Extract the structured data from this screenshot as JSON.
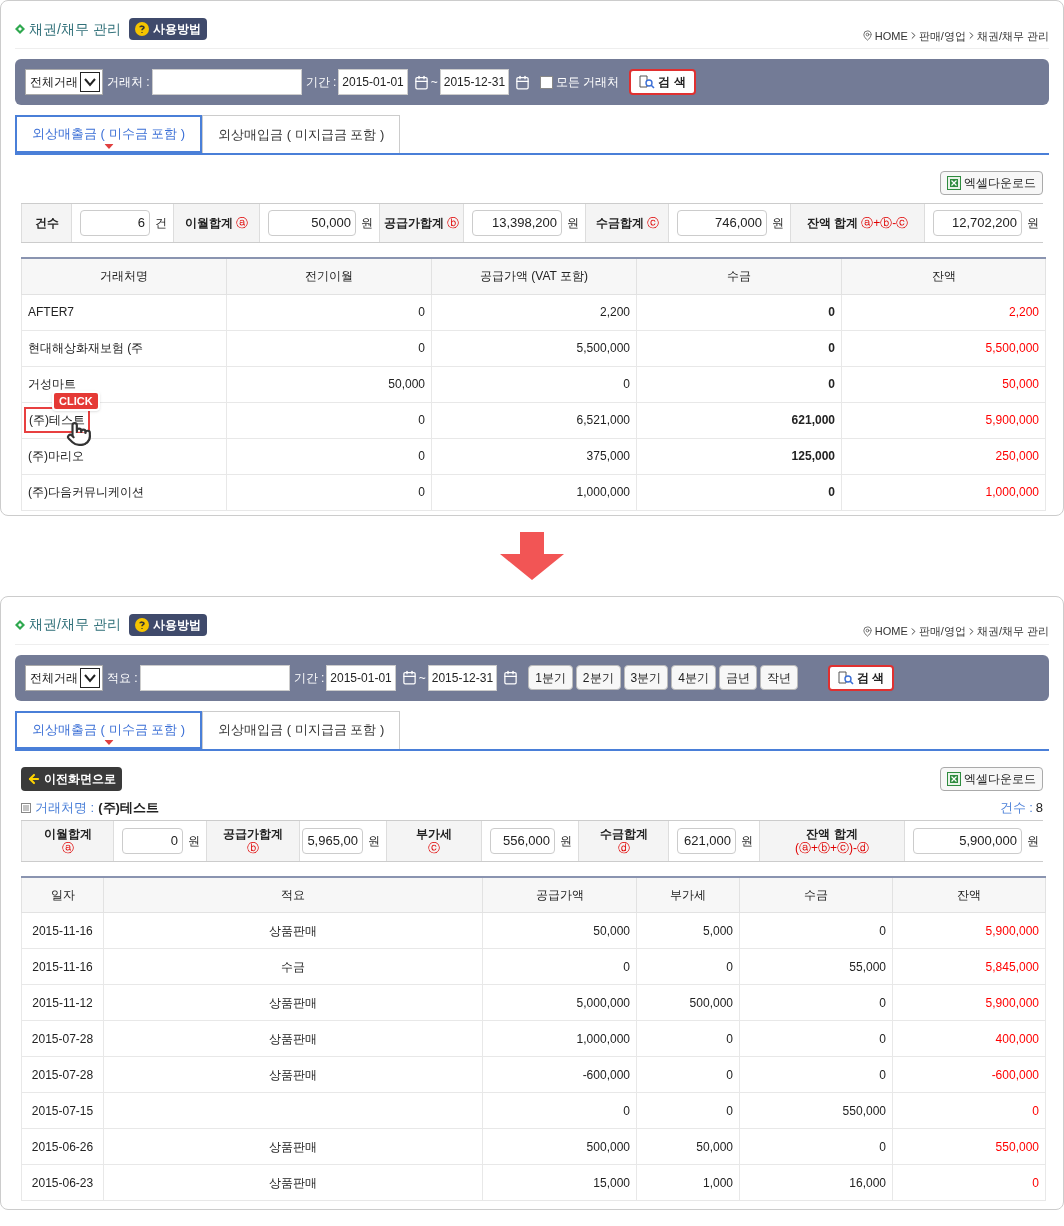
{
  "top_screen": {
    "header": {
      "title": "채권/채무 관리",
      "help_button": "사용방법",
      "breadcrumb": [
        "HOME",
        "판매/영업",
        "채권/채무 관리"
      ]
    },
    "filter": {
      "type_select": "전체거래",
      "keyword_label": "거래처 :",
      "period_label": "기간 :",
      "date_from": "2015-01-01",
      "date_separator": "~",
      "date_to": "2015-12-31",
      "all_clients": {
        "label": "모든 거래처",
        "checked": false
      },
      "search_button": "검 색"
    },
    "tabs": [
      {
        "label": "외상매출금 ( 미수금 포함 )",
        "selected": true
      },
      {
        "label": "외상매입금 ( 미지급금 포함 )",
        "selected": false
      }
    ],
    "excel_button": "엑셀다운로드",
    "summary": [
      {
        "label": "건수",
        "value": "6",
        "unit": "건"
      },
      {
        "label": "이월합계",
        "mark": "ⓐ",
        "value": "50,000",
        "unit": "원"
      },
      {
        "label": "공급가합계",
        "mark": "ⓑ",
        "value": "13,398,200",
        "unit": "원"
      },
      {
        "label": "수금합계",
        "mark": "ⓒ",
        "value": "746,000",
        "unit": "원"
      },
      {
        "label": "잔액 합계",
        "mark": "ⓐ+ⓑ-ⓒ",
        "value": "12,702,200",
        "unit": "원"
      }
    ],
    "table": {
      "columns": [
        "거래처명",
        "전기이월",
        "공급가액 (VAT 포함)",
        "수금",
        "잔액"
      ],
      "rows": [
        {
          "cells": [
            "AFTER7",
            "0",
            "2,200",
            "0",
            "2,200"
          ],
          "highlighted": false
        },
        {
          "cells": [
            "현대해상화재보험 (주",
            "0",
            "5,500,000",
            "0",
            "5,500,000"
          ],
          "highlighted": false
        },
        {
          "cells": [
            "거성마트",
            "50,000",
            "0",
            "0",
            "50,000"
          ],
          "highlighted": false
        },
        {
          "cells": [
            "(주)테스트",
            "0",
            "6,521,000",
            "621,000",
            "5,900,000"
          ],
          "highlighted": true
        },
        {
          "cells": [
            "(주)마리오",
            "0",
            "375,000",
            "125,000",
            "250,000"
          ],
          "highlighted": false
        },
        {
          "cells": [
            "(주)다음커뮤니케이션",
            "0",
            "1,000,000",
            "0",
            "1,000,000"
          ],
          "highlighted": false
        }
      ]
    },
    "callout": "CLICK"
  },
  "bottom_screen": {
    "header": {
      "title": "채권/채무 관리",
      "help_button": "사용방법",
      "breadcrumb": [
        "HOME",
        "판매/영업",
        "채권/채무 관리"
      ]
    },
    "filter": {
      "type_select": "전체거래",
      "keyword_label": "적요 :",
      "period_label": "기간 :",
      "date_from": "2015-01-01",
      "date_separator": "~",
      "date_to": "2015-12-31",
      "period_buttons": [
        "1분기",
        "2분기",
        "3분기",
        "4분기",
        "금년",
        "작년"
      ],
      "search_button": "검 색"
    },
    "tabs": [
      {
        "label": "외상매출금 ( 미수금 포함 )",
        "selected": true
      },
      {
        "label": "외상매입금 ( 미지급금 포함 )",
        "selected": false
      }
    ],
    "back_button": "이전화면으로",
    "excel_button": "엑셀다운로드",
    "client": {
      "label": "거래처명 :",
      "value": "(주)테스트"
    },
    "count": {
      "label": "건수 :",
      "value": "8"
    },
    "summary": [
      {
        "label": "이월합계",
        "mark": "ⓐ",
        "value": "0",
        "unit": "원"
      },
      {
        "label": "공급가합계",
        "mark": "ⓑ",
        "value": "5,965,00",
        "unit": "원"
      },
      {
        "label": "부가세",
        "mark": "ⓒ",
        "value": "556,000",
        "unit": "원"
      },
      {
        "label": "수금합계",
        "mark": "ⓓ",
        "value": "621,000",
        "unit": "원"
      },
      {
        "label": "잔액 합계",
        "mark": "(ⓐ+ⓑ+ⓒ)-ⓓ",
        "value": "5,900,000",
        "unit": "원"
      }
    ],
    "table": {
      "columns": [
        "일자",
        "적요",
        "공급가액",
        "부가세",
        "수금",
        "잔액"
      ],
      "rows": [
        [
          "2015-11-16",
          "상품판매",
          "50,000",
          "5,000",
          "0",
          "5,900,000"
        ],
        [
          "2015-11-16",
          "수금",
          "0",
          "0",
          "55,000",
          "5,845,000"
        ],
        [
          "2015-11-12",
          "상품판매",
          "5,000,000",
          "500,000",
          "0",
          "5,900,000"
        ],
        [
          "2015-07-28",
          "상품판매",
          "1,000,000",
          "0",
          "0",
          "400,000"
        ],
        [
          "2015-07-28",
          "상품판매",
          "-600,000",
          "0",
          "0",
          "-600,000"
        ],
        [
          "2015-07-15",
          "",
          "0",
          "0",
          "550,000",
          "0"
        ],
        [
          "2015-06-26",
          "상품판매",
          "500,000",
          "50,000",
          "0",
          "550,000"
        ],
        [
          "2015-06-23",
          "상품판매",
          "15,000",
          "1,000",
          "16,000",
          "0"
        ]
      ]
    }
  }
}
